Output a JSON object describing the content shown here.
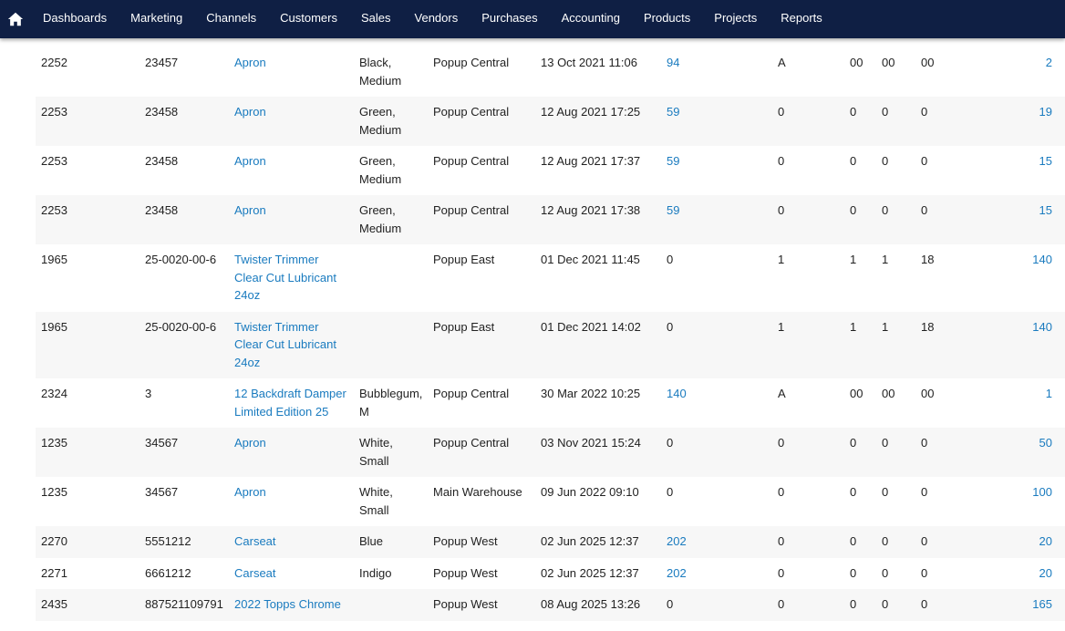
{
  "nav": {
    "home_icon": "home-icon",
    "items": [
      "Dashboards",
      "Marketing",
      "Channels",
      "Customers",
      "Sales",
      "Vendors",
      "Purchases",
      "Accounting",
      "Products",
      "Projects",
      "Reports"
    ]
  },
  "rows": [
    {
      "id": "2252",
      "sku": "23457",
      "product": "Apron",
      "variant": "Black, Medium",
      "location": "Popup Central",
      "date": "13 Oct 2021 11:06",
      "qty": "94",
      "qty_link": true,
      "c1": "A",
      "c2": "00",
      "c3": "00",
      "c4": "00",
      "total": "2"
    },
    {
      "id": "2253",
      "sku": "23458",
      "product": "Apron",
      "variant": "Green, Medium",
      "location": "Popup Central",
      "date": "12 Aug 2021 17:25",
      "qty": "59",
      "qty_link": true,
      "c1": "0",
      "c2": "0",
      "c3": "0",
      "c4": "0",
      "total": "19"
    },
    {
      "id": "2253",
      "sku": "23458",
      "product": "Apron",
      "variant": "Green, Medium",
      "location": "Popup Central",
      "date": "12 Aug 2021 17:37",
      "qty": "59",
      "qty_link": true,
      "c1": "0",
      "c2": "0",
      "c3": "0",
      "c4": "0",
      "total": "15"
    },
    {
      "id": "2253",
      "sku": "23458",
      "product": "Apron",
      "variant": "Green, Medium",
      "location": "Popup Central",
      "date": "12 Aug 2021 17:38",
      "qty": "59",
      "qty_link": true,
      "c1": "0",
      "c2": "0",
      "c3": "0",
      "c4": "0",
      "total": "15"
    },
    {
      "id": "1965",
      "sku": "25-0020-00-6",
      "product": "Twister Trimmer Clear Cut Lubricant 24oz",
      "variant": "",
      "location": "Popup East",
      "date": "01 Dec 2021 11:45",
      "qty": "0",
      "qty_link": false,
      "c1": "1",
      "c2": "1",
      "c3": "1",
      "c4": "18",
      "total": "140"
    },
    {
      "id": "1965",
      "sku": "25-0020-00-6",
      "product": "Twister Trimmer Clear Cut Lubricant 24oz",
      "variant": "",
      "location": "Popup East",
      "date": "01 Dec 2021 14:02",
      "qty": "0",
      "qty_link": false,
      "c1": "1",
      "c2": "1",
      "c3": "1",
      "c4": "18",
      "total": "140"
    },
    {
      "id": "2324",
      "sku": "3",
      "product": "12 Backdraft Damper Limited Edition 25",
      "variant": "Bubblegum, M",
      "location": "Popup Central",
      "date": "30 Mar 2022 10:25",
      "qty": "140",
      "qty_link": true,
      "c1": "A",
      "c2": "00",
      "c3": "00",
      "c4": "00",
      "total": "1"
    },
    {
      "id": "1235",
      "sku": "34567",
      "product": "Apron",
      "variant": "White, Small",
      "location": "Popup Central",
      "date": "03 Nov 2021 15:24",
      "qty": "0",
      "qty_link": false,
      "c1": "0",
      "c2": "0",
      "c3": "0",
      "c4": "0",
      "total": "50"
    },
    {
      "id": "1235",
      "sku": "34567",
      "product": "Apron",
      "variant": "White, Small",
      "location": "Main Warehouse",
      "date": "09 Jun 2022 09:10",
      "qty": "0",
      "qty_link": false,
      "c1": "0",
      "c2": "0",
      "c3": "0",
      "c4": "0",
      "total": "100"
    },
    {
      "id": "2270",
      "sku": "5551212",
      "product": "Carseat",
      "variant": "Blue",
      "location": "Popup West",
      "date": "02 Jun 2025 12:37",
      "qty": "202",
      "qty_link": true,
      "c1": "0",
      "c2": "0",
      "c3": "0",
      "c4": "0",
      "total": "20"
    },
    {
      "id": "2271",
      "sku": "6661212",
      "product": "Carseat",
      "variant": "Indigo",
      "location": "Popup West",
      "date": "02 Jun 2025 12:37",
      "qty": "202",
      "qty_link": true,
      "c1": "0",
      "c2": "0",
      "c3": "0",
      "c4": "0",
      "total": "20"
    },
    {
      "id": "2435",
      "sku": "887521109791",
      "product": "2022 Topps Chrome",
      "variant": "",
      "location": "Popup West",
      "date": "08 Aug 2025 13:26",
      "qty": "0",
      "qty_link": false,
      "c1": "0",
      "c2": "0",
      "c3": "0",
      "c4": "0",
      "total": "165"
    }
  ],
  "colors": {
    "navbar": "#0f1f44",
    "link": "#1a7bbf",
    "stripe": "#f7f7f7"
  }
}
